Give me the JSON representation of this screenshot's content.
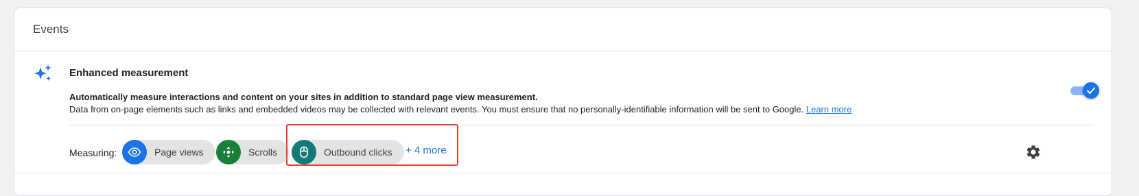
{
  "card": {
    "title": "Events"
  },
  "enhanced_measurement": {
    "title": "Enhanced measurement",
    "icon": "sparkle-icon",
    "description_bold": "Automatically measure interactions and content on your sites in addition to standard page view measurement.",
    "description": "Data from on-page elements such as links and embedded videos may be collected with relevant events. You must ensure that no personally-identifiable information will be sent to Google.",
    "learn_more": "Learn more",
    "toggle_enabled": true
  },
  "measuring": {
    "label": "Measuring:",
    "chips": [
      {
        "label": "Page views",
        "icon": "eye-icon",
        "color": "#1a73e8"
      },
      {
        "label": "Scrolls",
        "icon": "scroll-arrows-icon",
        "color": "#188038"
      },
      {
        "label": "Outbound clicks",
        "icon": "mouse-icon",
        "color": "#137a76"
      }
    ],
    "more_link": "+ 4 more",
    "settings_icon": "gear-icon"
  },
  "colors": {
    "accent": "#1a73e8",
    "highlight": "#e8432e"
  }
}
